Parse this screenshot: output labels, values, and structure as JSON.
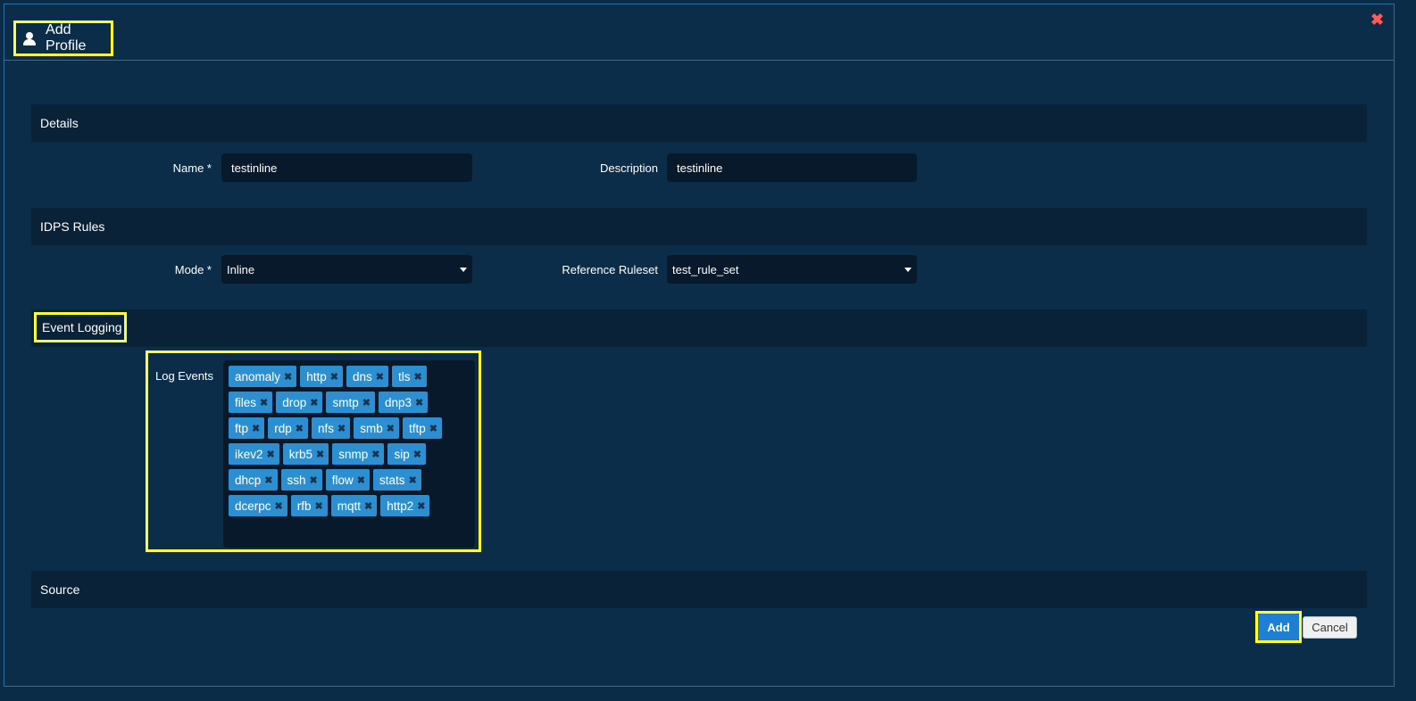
{
  "modal": {
    "title": "Add Profile",
    "close_label": "✖"
  },
  "sections": {
    "details": "Details",
    "rules": "IDPS Rules",
    "logging": "Event Logging",
    "source": "Source"
  },
  "details": {
    "name_label": "Name *",
    "name_value": "testinline",
    "description_label": "Description",
    "description_value": "testinline"
  },
  "rules": {
    "mode_label": "Mode *",
    "mode_value": "Inline",
    "ruleset_label": "Reference Ruleset",
    "ruleset_value": "test_rule_set"
  },
  "logging": {
    "log_events_label": "Log Events",
    "tags": [
      [
        "anomaly",
        "http",
        "dns",
        "tls"
      ],
      [
        "files",
        "drop",
        "smtp",
        "dnp3"
      ],
      [
        "ftp",
        "rdp",
        "nfs",
        "smb",
        "tftp"
      ],
      [
        "ikev2",
        "krb5",
        "snmp",
        "sip"
      ],
      [
        "dhcp",
        "ssh",
        "flow",
        "stats"
      ],
      [
        "dcerpc",
        "rfb",
        "mqtt",
        "http2"
      ]
    ]
  },
  "buttons": {
    "add": "Add",
    "cancel": "Cancel"
  },
  "colors": {
    "accent": "#2b8fd2",
    "highlight": "#ffff33",
    "primary_button": "#1e7fd4"
  }
}
